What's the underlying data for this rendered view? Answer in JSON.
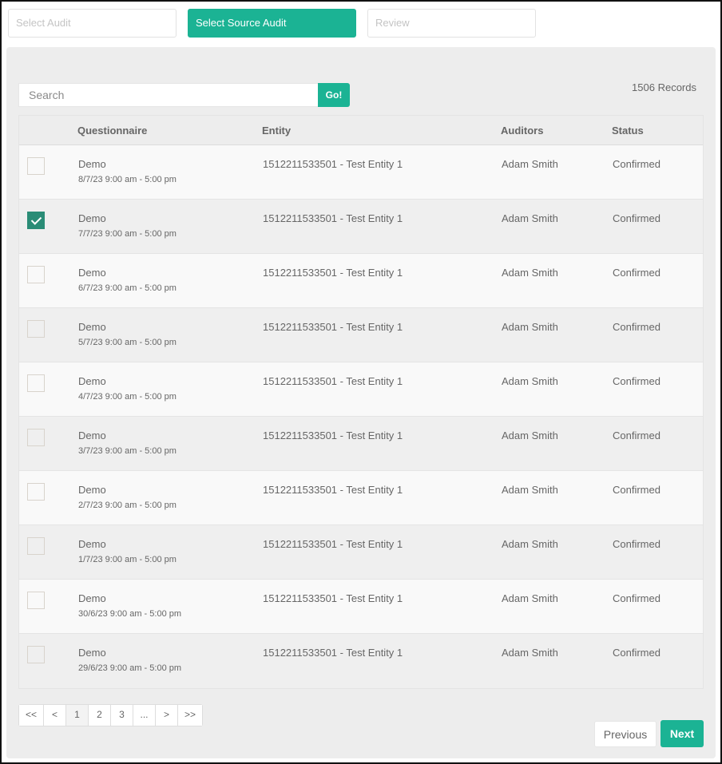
{
  "steps": [
    {
      "label": "Select Audit",
      "active": false
    },
    {
      "label": "Select Source Audit",
      "active": true
    },
    {
      "label": "Review",
      "active": false
    }
  ],
  "search": {
    "placeholder": "Search",
    "value": "",
    "button_label": "Go!"
  },
  "records_label": "1506 Records",
  "table": {
    "columns": [
      "",
      "Questionnaire",
      "Entity",
      "Auditors",
      "Status"
    ],
    "rows": [
      {
        "checked": false,
        "questionnaire": "Demo",
        "date": "8/7/23 9:00 am - 5:00 pm",
        "entity": "1512211533501 - Test Entity 1",
        "auditors": "Adam Smith",
        "status": "Confirmed"
      },
      {
        "checked": true,
        "questionnaire": "Demo",
        "date": "7/7/23 9:00 am - 5:00 pm",
        "entity": "1512211533501 - Test Entity 1",
        "auditors": "Adam Smith",
        "status": "Confirmed"
      },
      {
        "checked": false,
        "questionnaire": "Demo",
        "date": "6/7/23 9:00 am - 5:00 pm",
        "entity": "1512211533501 - Test Entity 1",
        "auditors": "Adam Smith",
        "status": "Confirmed"
      },
      {
        "checked": false,
        "questionnaire": "Demo",
        "date": "5/7/23 9:00 am - 5:00 pm",
        "entity": "1512211533501 - Test Entity 1",
        "auditors": "Adam Smith",
        "status": "Confirmed"
      },
      {
        "checked": false,
        "questionnaire": "Demo",
        "date": "4/7/23 9:00 am - 5:00 pm",
        "entity": "1512211533501 - Test Entity 1",
        "auditors": "Adam Smith",
        "status": "Confirmed"
      },
      {
        "checked": false,
        "questionnaire": "Demo",
        "date": "3/7/23 9:00 am - 5:00 pm",
        "entity": "1512211533501 - Test Entity 1",
        "auditors": "Adam Smith",
        "status": "Confirmed"
      },
      {
        "checked": false,
        "questionnaire": "Demo",
        "date": "2/7/23 9:00 am - 5:00 pm",
        "entity": "1512211533501 - Test Entity 1",
        "auditors": "Adam Smith",
        "status": "Confirmed"
      },
      {
        "checked": false,
        "questionnaire": "Demo",
        "date": "1/7/23 9:00 am - 5:00 pm",
        "entity": "1512211533501 - Test Entity 1",
        "auditors": "Adam Smith",
        "status": "Confirmed"
      },
      {
        "checked": false,
        "questionnaire": "Demo",
        "date": "30/6/23 9:00 am - 5:00 pm",
        "entity": "1512211533501 - Test Entity 1",
        "auditors": "Adam Smith",
        "status": "Confirmed"
      },
      {
        "checked": false,
        "questionnaire": "Demo",
        "date": "29/6/23 9:00 am - 5:00 pm",
        "entity": "1512211533501 - Test Entity 1",
        "auditors": "Adam Smith",
        "status": "Confirmed"
      }
    ]
  },
  "pagination": {
    "items": [
      "<<",
      "<",
      "1",
      "2",
      "3",
      "...",
      ">",
      ">>"
    ],
    "current": "1"
  },
  "footer": {
    "previous_label": "Previous",
    "next_label": "Next"
  },
  "colors": {
    "accent": "#1bb394",
    "checkbox_checked": "#2a8c76",
    "panel_bg": "#ededed"
  }
}
